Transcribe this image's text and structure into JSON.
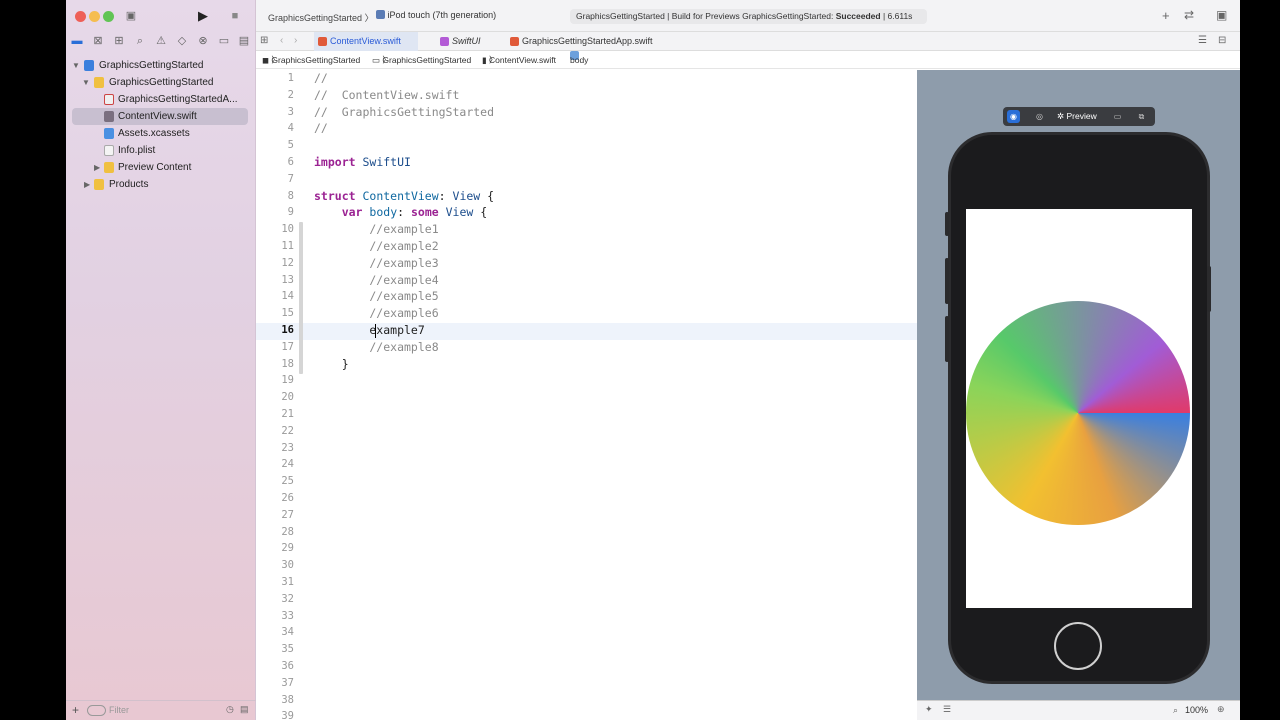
{
  "toolbar": {
    "scheme": "GraphicsGettingStarted",
    "destination": "iPod touch (7th generation)",
    "status_prefix": "GraphicsGettingStarted | Build for Previews GraphicsGettingStarted:",
    "status_result": "Succeeded",
    "status_time": "| 6.611s"
  },
  "sidebar": {
    "items": [
      {
        "label": "GraphicsGettingStarted",
        "kind": "project",
        "level": 0,
        "expanded": true
      },
      {
        "label": "GraphicsGettingStarted",
        "kind": "folder",
        "level": 1,
        "expanded": true
      },
      {
        "label": "GraphicsGettingStartedA...",
        "kind": "swift-file",
        "level": 2
      },
      {
        "label": "ContentView.swift",
        "kind": "swift-file",
        "level": 2,
        "selected": true
      },
      {
        "label": "Assets.xcassets",
        "kind": "assets",
        "level": 2
      },
      {
        "label": "Info.plist",
        "kind": "plist",
        "level": 2
      },
      {
        "label": "Preview Content",
        "kind": "folder",
        "level": 2,
        "expanded": false
      },
      {
        "label": "Products",
        "kind": "folder",
        "level": 1,
        "expanded": false
      }
    ],
    "filter_placeholder": "Filter"
  },
  "tabs": [
    {
      "label": "ContentView.swift",
      "active": true
    },
    {
      "label": "SwiftUI",
      "active": false
    },
    {
      "label": "GraphicsGettingStartedApp.swift",
      "active": false
    }
  ],
  "jumpbar": [
    "GraphicsGettingStarted",
    "GraphicsGettingStarted",
    "ContentView.swift",
    "body"
  ],
  "editor": {
    "current_line": 16,
    "lines": [
      {
        "n": "1",
        "t": "//"
      },
      {
        "n": "2",
        "t": "//  ContentView.swift"
      },
      {
        "n": "3",
        "t": "//  GraphicsGettingStarted"
      },
      {
        "n": "4",
        "t": "//"
      },
      {
        "n": "5",
        "t": ""
      },
      {
        "n": "6",
        "t": "import SwiftUI"
      },
      {
        "n": "7",
        "t": ""
      },
      {
        "n": "8",
        "t": "struct ContentView: View {"
      },
      {
        "n": "9",
        "t": "    var body: some View {"
      },
      {
        "n": "10",
        "t": "        //example1"
      },
      {
        "n": "11",
        "t": "        //example2"
      },
      {
        "n": "12",
        "t": "        //example3"
      },
      {
        "n": "13",
        "t": "        //example4"
      },
      {
        "n": "14",
        "t": "        //example5"
      },
      {
        "n": "15",
        "t": "        //example6"
      },
      {
        "n": "16",
        "t": "        example7"
      },
      {
        "n": "17",
        "t": "        //example8"
      },
      {
        "n": "18",
        "t": "    }"
      },
      {
        "n": "19",
        "t": ""
      },
      {
        "n": "20",
        "t": ""
      },
      {
        "n": "21",
        "t": ""
      },
      {
        "n": "22",
        "t": ""
      },
      {
        "n": "23",
        "t": ""
      },
      {
        "n": "24",
        "t": ""
      },
      {
        "n": "25",
        "t": ""
      },
      {
        "n": "26",
        "t": ""
      },
      {
        "n": "27",
        "t": ""
      },
      {
        "n": "28",
        "t": ""
      },
      {
        "n": "29",
        "t": ""
      },
      {
        "n": "30",
        "t": ""
      },
      {
        "n": "31",
        "t": ""
      },
      {
        "n": "32",
        "t": ""
      },
      {
        "n": "33",
        "t": ""
      },
      {
        "n": "34",
        "t": ""
      },
      {
        "n": "35",
        "t": ""
      },
      {
        "n": "36",
        "t": ""
      },
      {
        "n": "37",
        "t": ""
      },
      {
        "n": "38",
        "t": ""
      },
      {
        "n": "39",
        "t": ""
      }
    ]
  },
  "preview": {
    "label": "Preview",
    "zoom": "100%"
  },
  "colors": {
    "accent": "#2a5bd7",
    "keyword": "#9b2393",
    "type": "#1c4d8c",
    "comment": "#8a8a8a"
  }
}
